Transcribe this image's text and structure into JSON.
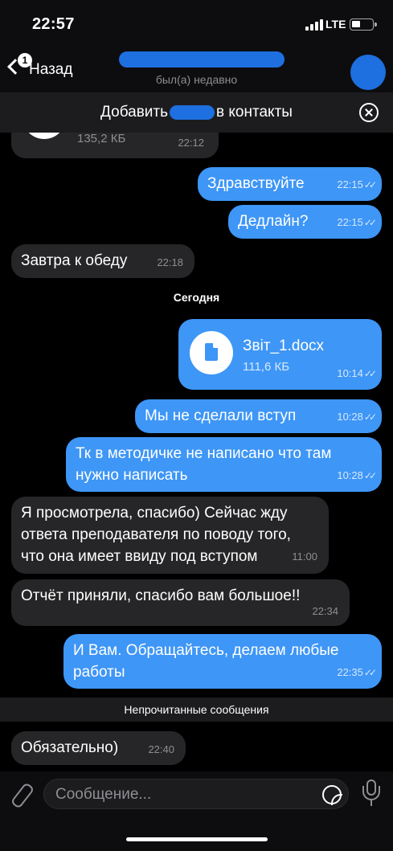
{
  "status_bar": {
    "time": "22:57",
    "network": "LTE"
  },
  "header": {
    "back_label": "Назад",
    "back_badge": "1",
    "last_seen": "был(а) недавно"
  },
  "banner": {
    "text_before": "Добавить",
    "text_after": "в контакты"
  },
  "messages": [
    {
      "dir": "in",
      "text": "135,2 КБ",
      "time": "22:12",
      "type": "file_partial"
    },
    {
      "dir": "out",
      "text": "Здравствуйте",
      "time": "22:15"
    },
    {
      "dir": "out",
      "text": "Дедлайн?",
      "time": "22:15"
    },
    {
      "dir": "in",
      "text": "Завтра к обеду",
      "time": "22:18"
    },
    {
      "dir": "out",
      "type": "file",
      "file_name": "Звіт_1.docx",
      "file_size": "111,6 КБ",
      "time": "10:14"
    },
    {
      "dir": "out",
      "text": "Мы не сделали вступ",
      "time": "10:28"
    },
    {
      "dir": "out",
      "text": "Тк в методичке не написано что там\nнужно написать",
      "time": "10:28"
    },
    {
      "dir": "in",
      "text": "Я просмотрела, спасибо) Сейчас жду\nответа преподавателя по поводу того,\nчто она имеет ввиду под вступом",
      "time": "11:00"
    },
    {
      "dir": "in",
      "text": "Отчёт приняли, спасибо вам большое!!",
      "time": "22:34"
    },
    {
      "dir": "out",
      "text": "И Вам. Обращайтесь, делаем любые\nработы",
      "time": "22:35"
    },
    {
      "dir": "in",
      "text": "Обязательно)",
      "time": "22:40"
    }
  ],
  "date_separator": "Сегодня",
  "unread_label": "Непрочитанные сообщения",
  "input": {
    "placeholder": "Сообщение..."
  },
  "colors": {
    "outgoing_bubble": "#3e96f6",
    "incoming_bubble": "#262628",
    "redaction": "#1e6fe0"
  }
}
